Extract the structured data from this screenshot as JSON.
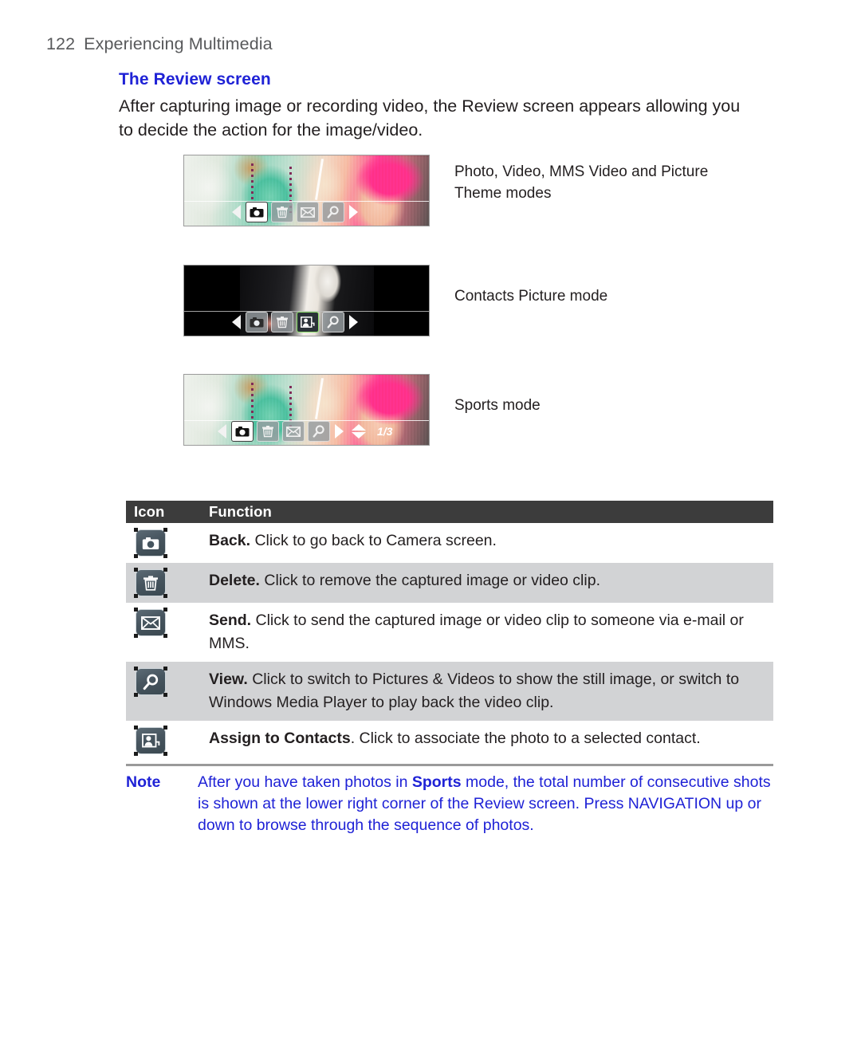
{
  "page": {
    "number": "122",
    "running_title": "Experiencing Multimedia"
  },
  "heading": "The Review screen",
  "intro": "After capturing image or recording video, the Review screen appears allowing you to decide the action for the image/video.",
  "figures": [
    {
      "caption": "Photo, Video, MMS Video and Picture Theme modes",
      "toolbar_icons": [
        "arrow-left",
        "camera",
        "trash",
        "envelope",
        "magnifier",
        "arrow-right"
      ],
      "selected": "camera"
    },
    {
      "caption": "Contacts Picture mode",
      "toolbar_icons": [
        "arrow-left",
        "camera",
        "trash",
        "assign-to-contacts",
        "magnifier",
        "arrow-right"
      ],
      "selected": "assign-to-contacts"
    },
    {
      "caption": "Sports mode",
      "toolbar_icons": [
        "arrow-left",
        "camera",
        "trash",
        "envelope",
        "magnifier",
        "arrow-right",
        "arrow-up-down"
      ],
      "selected": "camera",
      "counter": "1/3"
    }
  ],
  "table": {
    "headers": {
      "icon": "Icon",
      "function": "Function"
    },
    "rows": [
      {
        "icon": "camera-icon",
        "term": "Back.",
        "text": " Click to go back to Camera screen."
      },
      {
        "icon": "trash-icon",
        "term": "Delete.",
        "text": " Click to remove the captured image or video clip."
      },
      {
        "icon": "envelope-icon",
        "term": "Send.",
        "text": " Click to send the captured image or video clip to someone via e-mail or MMS."
      },
      {
        "icon": "magnifier-icon",
        "term": "View.",
        "text": " Click to switch to Pictures & Videos to show the still image, or switch to Windows Media Player to play back the video clip."
      },
      {
        "icon": "assign-contacts-icon",
        "term": "Assign to Contacts",
        "text": ". Click to associate the photo to a selected contact."
      }
    ]
  },
  "note": {
    "label": "Note",
    "part1": "After you have taken photos in ",
    "bold": "Sports",
    "part2": " mode, the total number of consecutive shots is shown at the lower right corner of the Review screen. Press NAVIGATION up or down to browse through the sequence of photos."
  },
  "colors": {
    "accent_blue": "#1f22d6",
    "header_dark": "#3c3c3c",
    "row_alt": "#d2d3d5",
    "text": "#231f20",
    "running_head": "#58595b"
  }
}
